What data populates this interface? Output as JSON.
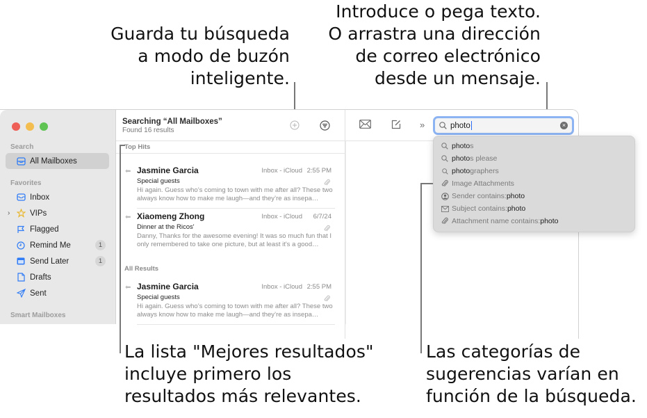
{
  "callouts": {
    "save_search": [
      "Guarda tu búsqueda",
      "a modo de buzón",
      "inteligente."
    ],
    "search_field": [
      "Introduce o pega texto.",
      "O arrastra una dirección",
      "de correo electrónico",
      "desde un mensaje."
    ],
    "top_hits": [
      "La lista \"Mejores resultados\"",
      "incluye primero los",
      "resultados más relevantes."
    ],
    "categories": [
      "Las categorías de",
      "sugerencias varían en",
      "función de la búsqueda."
    ]
  },
  "window": {
    "traffic_lights": {
      "close": "#ee5f57",
      "minimize": "#f4bd50",
      "zoom": "#5fc454"
    }
  },
  "sidebar": {
    "search_section": "Search",
    "search_item": {
      "label": "All Mailboxes",
      "icon": "all-mailboxes-icon",
      "selected": true
    },
    "favorites_section": "Favorites",
    "items": [
      {
        "label": "Inbox",
        "icon": "inbox-icon",
        "badge": null
      },
      {
        "label": "VIPs",
        "icon": "star-icon",
        "badge": null,
        "collapsed": true
      },
      {
        "label": "Flagged",
        "icon": "flag-icon",
        "badge": null
      },
      {
        "label": "Remind Me",
        "icon": "clock-icon",
        "badge": "1"
      },
      {
        "label": "Send Later",
        "icon": "calendar-icon",
        "badge": "1"
      },
      {
        "label": "Drafts",
        "icon": "document-icon",
        "badge": null
      },
      {
        "label": "Sent",
        "icon": "paper-plane-icon",
        "badge": null
      }
    ],
    "smart_section": "Smart Mailboxes"
  },
  "list": {
    "title": "Searching “All Mailboxes”",
    "subtitle": "Found 16 results",
    "top_hits_label": "Top Hits",
    "all_results_label": "All Results",
    "top_hits": [
      {
        "sender": "Jasmine Garcia",
        "mailbox": "Inbox - iCloud",
        "date": "2:55 PM",
        "subject": "Special guests",
        "preview": "Hi again. Guess who’s coming to town with me after all? These two always know how to make me laugh—and they’re as insepa…",
        "replied": true,
        "attachment": true
      },
      {
        "sender": "Xiaomeng Zhong",
        "mailbox": "Inbox - iCloud",
        "date": "6/7/24",
        "subject": "Dinner at the Ricos'",
        "preview": "Danny, Thanks for the awesome evening! It was so much fun that I only remembered to take one picture, but at least it's a good…",
        "replied": true,
        "attachment": true
      }
    ],
    "all_results": [
      {
        "sender": "Jasmine Garcia",
        "mailbox": "Inbox - iCloud",
        "date": "2:55 PM",
        "subject": "Special guests",
        "preview": "Hi again. Guess who’s coming to town with me after all? These two always know how to make me laugh—and they’re as insepa…",
        "replied": true,
        "attachment": true
      }
    ]
  },
  "toolbar": {
    "search_value": "photo"
  },
  "suggestions": [
    {
      "icon": "search-icon",
      "match": "photo",
      "rest": "s",
      "prefix": ""
    },
    {
      "icon": "search-icon",
      "match": "photo",
      "rest": "s please",
      "prefix": ""
    },
    {
      "icon": "search-icon",
      "match": "photo",
      "rest": "graphers",
      "prefix": ""
    },
    {
      "icon": "paperclip-icon",
      "match": "",
      "rest": "",
      "prefix": "Image Attachments"
    },
    {
      "icon": "person-icon",
      "match": "photo",
      "rest": "",
      "prefix": "Sender contains: "
    },
    {
      "icon": "envelope-icon",
      "match": "photo",
      "rest": "",
      "prefix": "Subject contains: "
    },
    {
      "icon": "paperclip-icon",
      "match": "photo",
      "rest": "",
      "prefix": "Attachment name contains: "
    }
  ]
}
